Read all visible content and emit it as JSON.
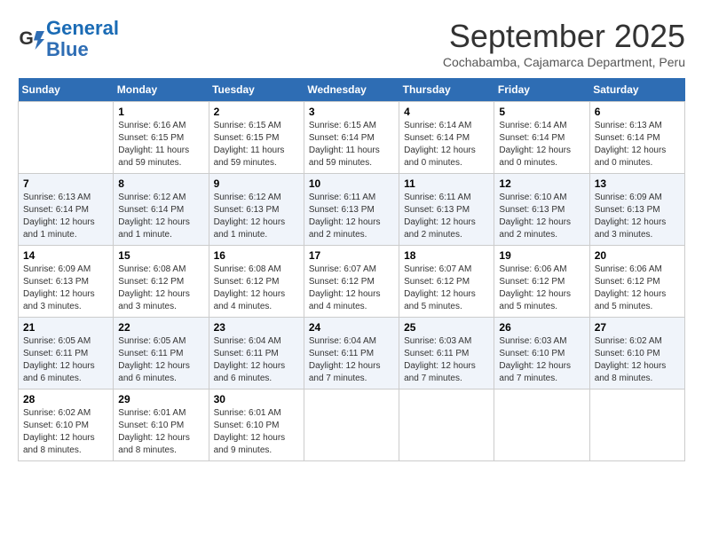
{
  "header": {
    "logo_line1": "General",
    "logo_line2": "Blue",
    "month": "September 2025",
    "location": "Cochabamba, Cajamarca Department, Peru"
  },
  "days_of_week": [
    "Sunday",
    "Monday",
    "Tuesday",
    "Wednesday",
    "Thursday",
    "Friday",
    "Saturday"
  ],
  "weeks": [
    [
      {
        "day": "",
        "info": ""
      },
      {
        "day": "1",
        "info": "Sunrise: 6:16 AM\nSunset: 6:15 PM\nDaylight: 11 hours\nand 59 minutes."
      },
      {
        "day": "2",
        "info": "Sunrise: 6:15 AM\nSunset: 6:15 PM\nDaylight: 11 hours\nand 59 minutes."
      },
      {
        "day": "3",
        "info": "Sunrise: 6:15 AM\nSunset: 6:14 PM\nDaylight: 11 hours\nand 59 minutes."
      },
      {
        "day": "4",
        "info": "Sunrise: 6:14 AM\nSunset: 6:14 PM\nDaylight: 12 hours\nand 0 minutes."
      },
      {
        "day": "5",
        "info": "Sunrise: 6:14 AM\nSunset: 6:14 PM\nDaylight: 12 hours\nand 0 minutes."
      },
      {
        "day": "6",
        "info": "Sunrise: 6:13 AM\nSunset: 6:14 PM\nDaylight: 12 hours\nand 0 minutes."
      }
    ],
    [
      {
        "day": "7",
        "info": "Sunrise: 6:13 AM\nSunset: 6:14 PM\nDaylight: 12 hours\nand 1 minute."
      },
      {
        "day": "8",
        "info": "Sunrise: 6:12 AM\nSunset: 6:14 PM\nDaylight: 12 hours\nand 1 minute."
      },
      {
        "day": "9",
        "info": "Sunrise: 6:12 AM\nSunset: 6:13 PM\nDaylight: 12 hours\nand 1 minute."
      },
      {
        "day": "10",
        "info": "Sunrise: 6:11 AM\nSunset: 6:13 PM\nDaylight: 12 hours\nand 2 minutes."
      },
      {
        "day": "11",
        "info": "Sunrise: 6:11 AM\nSunset: 6:13 PM\nDaylight: 12 hours\nand 2 minutes."
      },
      {
        "day": "12",
        "info": "Sunrise: 6:10 AM\nSunset: 6:13 PM\nDaylight: 12 hours\nand 2 minutes."
      },
      {
        "day": "13",
        "info": "Sunrise: 6:09 AM\nSunset: 6:13 PM\nDaylight: 12 hours\nand 3 minutes."
      }
    ],
    [
      {
        "day": "14",
        "info": "Sunrise: 6:09 AM\nSunset: 6:13 PM\nDaylight: 12 hours\nand 3 minutes."
      },
      {
        "day": "15",
        "info": "Sunrise: 6:08 AM\nSunset: 6:12 PM\nDaylight: 12 hours\nand 3 minutes."
      },
      {
        "day": "16",
        "info": "Sunrise: 6:08 AM\nSunset: 6:12 PM\nDaylight: 12 hours\nand 4 minutes."
      },
      {
        "day": "17",
        "info": "Sunrise: 6:07 AM\nSunset: 6:12 PM\nDaylight: 12 hours\nand 4 minutes."
      },
      {
        "day": "18",
        "info": "Sunrise: 6:07 AM\nSunset: 6:12 PM\nDaylight: 12 hours\nand 5 minutes."
      },
      {
        "day": "19",
        "info": "Sunrise: 6:06 AM\nSunset: 6:12 PM\nDaylight: 12 hours\nand 5 minutes."
      },
      {
        "day": "20",
        "info": "Sunrise: 6:06 AM\nSunset: 6:12 PM\nDaylight: 12 hours\nand 5 minutes."
      }
    ],
    [
      {
        "day": "21",
        "info": "Sunrise: 6:05 AM\nSunset: 6:11 PM\nDaylight: 12 hours\nand 6 minutes."
      },
      {
        "day": "22",
        "info": "Sunrise: 6:05 AM\nSunset: 6:11 PM\nDaylight: 12 hours\nand 6 minutes."
      },
      {
        "day": "23",
        "info": "Sunrise: 6:04 AM\nSunset: 6:11 PM\nDaylight: 12 hours\nand 6 minutes."
      },
      {
        "day": "24",
        "info": "Sunrise: 6:04 AM\nSunset: 6:11 PM\nDaylight: 12 hours\nand 7 minutes."
      },
      {
        "day": "25",
        "info": "Sunrise: 6:03 AM\nSunset: 6:11 PM\nDaylight: 12 hours\nand 7 minutes."
      },
      {
        "day": "26",
        "info": "Sunrise: 6:03 AM\nSunset: 6:10 PM\nDaylight: 12 hours\nand 7 minutes."
      },
      {
        "day": "27",
        "info": "Sunrise: 6:02 AM\nSunset: 6:10 PM\nDaylight: 12 hours\nand 8 minutes."
      }
    ],
    [
      {
        "day": "28",
        "info": "Sunrise: 6:02 AM\nSunset: 6:10 PM\nDaylight: 12 hours\nand 8 minutes."
      },
      {
        "day": "29",
        "info": "Sunrise: 6:01 AM\nSunset: 6:10 PM\nDaylight: 12 hours\nand 8 minutes."
      },
      {
        "day": "30",
        "info": "Sunrise: 6:01 AM\nSunset: 6:10 PM\nDaylight: 12 hours\nand 9 minutes."
      },
      {
        "day": "",
        "info": ""
      },
      {
        "day": "",
        "info": ""
      },
      {
        "day": "",
        "info": ""
      },
      {
        "day": "",
        "info": ""
      }
    ]
  ]
}
